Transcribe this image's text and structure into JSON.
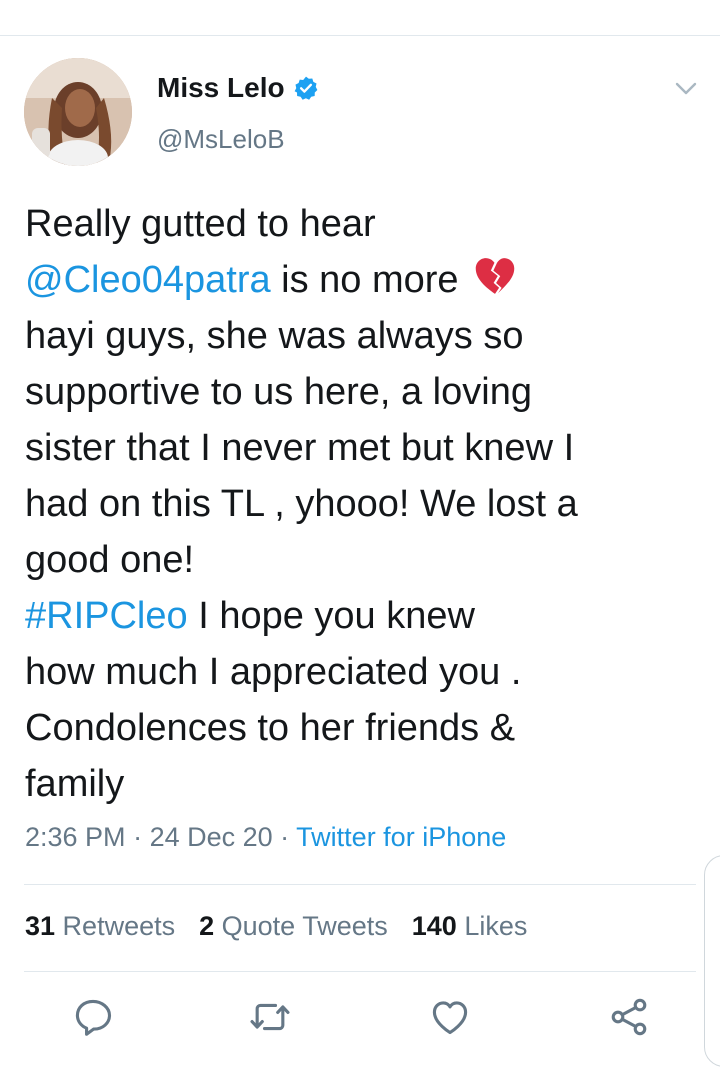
{
  "user": {
    "display_name": "Miss Lelo",
    "handle": "@MsLeloB",
    "verified": true
  },
  "tweet": {
    "lines": [
      {
        "parts": [
          {
            "text": "Really gutted to hear",
            "type": "text"
          }
        ]
      },
      {
        "parts": [
          {
            "text": "@Cleo04patra",
            "type": "mention"
          },
          {
            "text": " is no more ",
            "type": "text"
          }
        ],
        "emoji": "broken-heart-icon"
      },
      {
        "parts": [
          {
            "text": "hayi guys, she was always so",
            "type": "text"
          }
        ]
      },
      {
        "parts": [
          {
            "text": "supportive to us here, a loving",
            "type": "text"
          }
        ]
      },
      {
        "parts": [
          {
            "text": "sister that I never met but knew I",
            "type": "text"
          }
        ]
      },
      {
        "parts": [
          {
            "text": "had on this TL , yhooo! We lost a",
            "type": "text"
          }
        ]
      },
      {
        "parts": [
          {
            "text": "good one!",
            "type": "text"
          }
        ]
      },
      {
        "parts": [
          {
            "text": "#RIPCleo",
            "type": "hashtag"
          },
          {
            "text": " I hope you knew",
            "type": "text"
          }
        ]
      },
      {
        "parts": [
          {
            "text": "how much I appreciated you .",
            "type": "text"
          }
        ]
      },
      {
        "parts": [
          {
            "text": "Condolences to her friends &",
            "type": "text"
          }
        ]
      },
      {
        "parts": [
          {
            "text": "family",
            "type": "text"
          }
        ]
      }
    ],
    "time": "2:36 PM",
    "separator": " · ",
    "date": "24 Dec 20",
    "source": "Twitter for iPhone"
  },
  "stats": {
    "retweets_count": "31",
    "retweets_label": " Retweets",
    "quotes_count": "2",
    "quotes_label": " Quote Tweets",
    "likes_count": "140",
    "likes_label": " Likes"
  },
  "colors": {
    "link": "#1b95e0",
    "secondary_text": "#657786",
    "primary_text": "#14171a",
    "divider": "#e1e8ed"
  },
  "icons": {
    "more": "chevron-down-icon",
    "reply": "reply-icon",
    "retweet": "retweet-icon",
    "like": "heart-icon",
    "share": "share-icon"
  }
}
